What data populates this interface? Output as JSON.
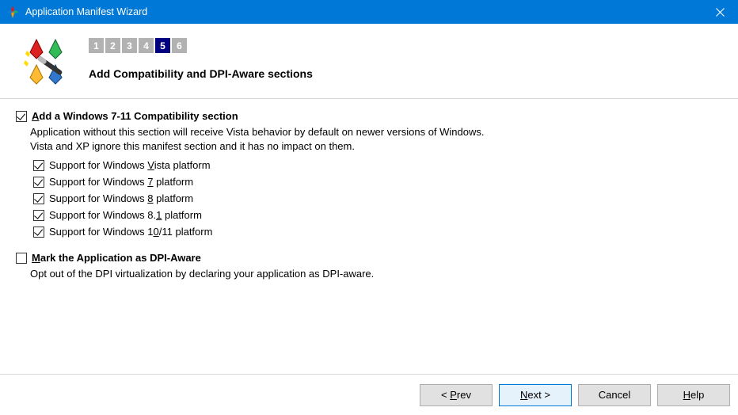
{
  "window": {
    "title": "Application Manifest Wizard"
  },
  "wizard": {
    "steps": [
      "1",
      "2",
      "3",
      "4",
      "5",
      "6"
    ],
    "active_step_index": 4,
    "heading": "Add Compatibility and DPI-Aware sections"
  },
  "compat": {
    "label_pre": "A",
    "label_post": "dd a Windows 7-11 Compatibility section",
    "checked": true,
    "desc_line1": "Application without this section will receive Vista behavior by default on newer versions of Windows.",
    "desc_line2": "Vista and XP ignore this manifest section and it has no impact on them.",
    "items": [
      {
        "checked": true,
        "pre": "Support for Windows ",
        "mn": "V",
        "post": "ista platform"
      },
      {
        "checked": true,
        "pre": "Support for Windows ",
        "mn": "7",
        "post": " platform"
      },
      {
        "checked": true,
        "pre": "Support for Windows ",
        "mn": "8",
        "post": " platform"
      },
      {
        "checked": true,
        "pre": "Support for Windows 8.",
        "mn": "1",
        "post": " platform"
      },
      {
        "checked": true,
        "pre": "Support for Windows 1",
        "mn": "0",
        "post": "/11 platform"
      }
    ]
  },
  "dpi": {
    "label_pre": "M",
    "label_post": "ark the Application as DPI-Aware",
    "checked": false,
    "desc": "Opt out of the DPI virtualization by declaring your application as DPI-aware."
  },
  "buttons": {
    "prev_pre": "< ",
    "prev_mn": "P",
    "prev_post": "rev",
    "next_pre": "",
    "next_mn": "N",
    "next_post": "ext >",
    "cancel": "Cancel",
    "help_mn": "H",
    "help_post": "elp"
  }
}
